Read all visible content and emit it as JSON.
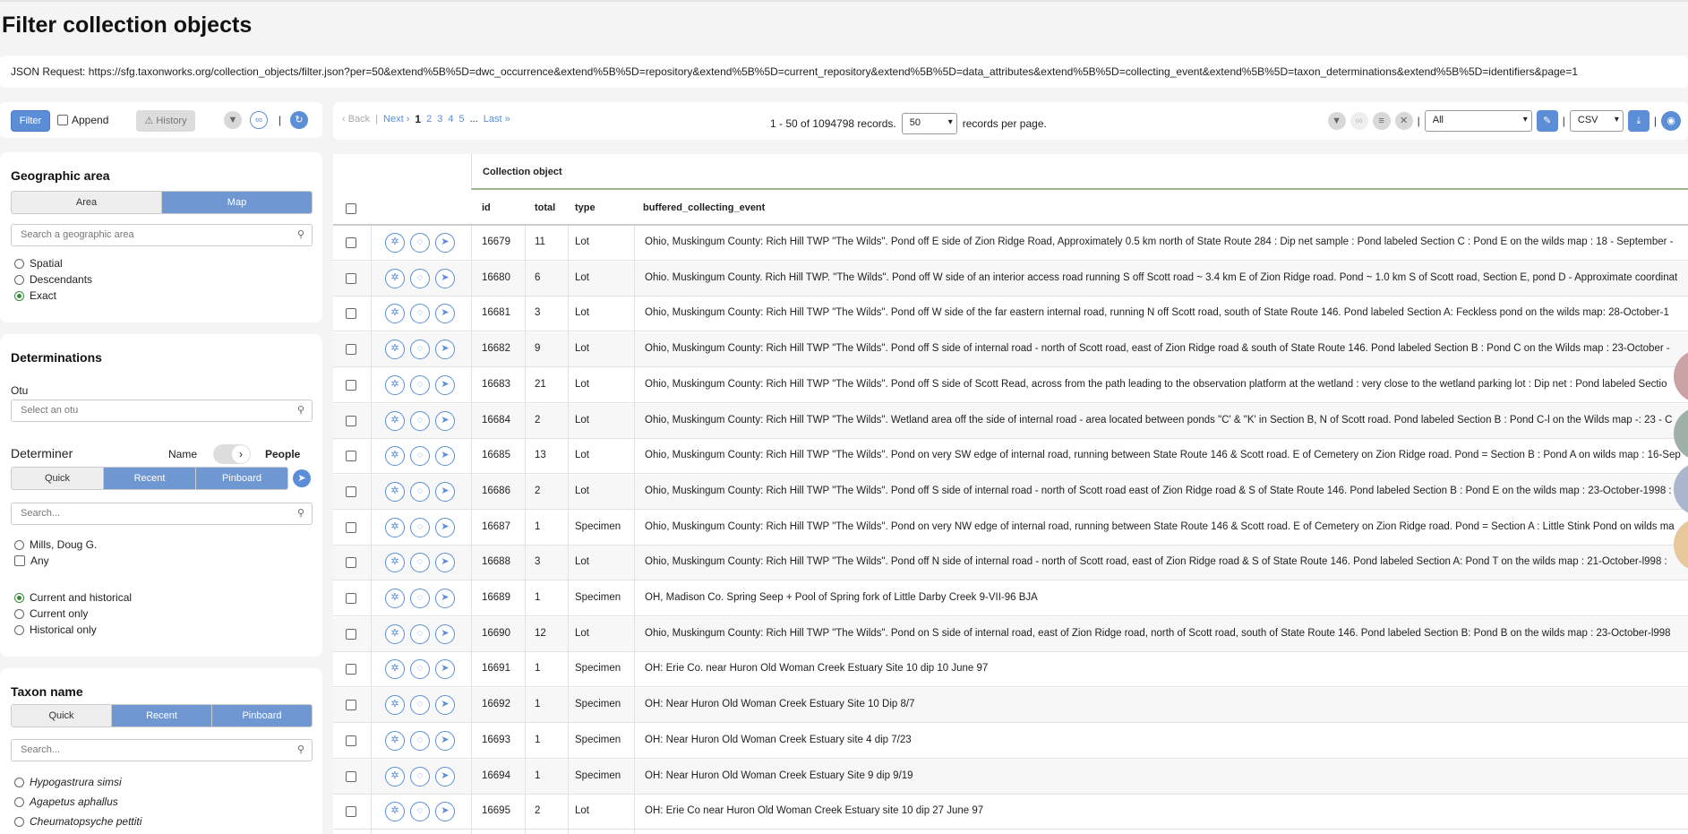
{
  "page": {
    "title": "Filter collection objects",
    "json_request": "JSON Request: https://sfg.taxonworks.org/collection_objects/filter.json?per=50&extend%5B%5D=dwc_occurrence&extend%5B%5D=repository&extend%5B%5D=current_repository&extend%5B%5D=data_attributes&extend%5B%5D=collecting_event&extend%5B%5D=taxon_determinations&extend%5B%5D=identifiers&page=1"
  },
  "filter_bar": {
    "filter_label": "Filter",
    "append_label": "Append",
    "history_label": "History",
    "pipe": "|"
  },
  "geographic": {
    "heading": "Geographic area",
    "tabs": [
      "Area",
      "Map"
    ],
    "placeholder": "Search a geographic area",
    "options": [
      "Spatial",
      "Descendants",
      "Exact"
    ]
  },
  "determinations": {
    "heading": "Determinations",
    "otu_label": "Otu",
    "otu_placeholder": "Select an otu",
    "determiner_label": "Determiner",
    "toggle_left": "Name",
    "toggle_right": "People",
    "tabs": [
      "Quick",
      "Recent",
      "Pinboard"
    ],
    "search_placeholder": "Search...",
    "person": "Mills, Doug G.",
    "any_label": "Any",
    "scope_options": [
      "Current and historical",
      "Current only",
      "Historical only"
    ]
  },
  "taxon": {
    "heading": "Taxon name",
    "tabs": [
      "Quick",
      "Recent",
      "Pinboard"
    ],
    "search_placeholder": "Search...",
    "names": [
      "Hypogastrura simsi",
      "Agapetus aphallus",
      "Cheumatopsyche pettiti"
    ]
  },
  "pager": {
    "back": "‹ Back",
    "sep": "|",
    "next": "Next ›",
    "pages": [
      "1",
      "2",
      "3",
      "4",
      "5"
    ],
    "ellipsis": "...",
    "last": "Last »",
    "records_text": "1 - 50 of 1094798 records.",
    "per_page_value": "50",
    "per_page_label": "records per page.",
    "layout_value": "All",
    "export_value": "CSV"
  },
  "table": {
    "group_header": "Collection object",
    "columns": [
      "id",
      "total",
      "type",
      "buffered_collecting_event"
    ],
    "rows": [
      {
        "id": "16679",
        "total": "11",
        "type": "Lot",
        "event": "Ohio, Muskingum County: Rich Hill TWP \"The Wilds\". Pond off E side of Zion Ridge Road, Approximately 0.5 km north of State Route 284 : Dip net sample : Pond labeled Section C : Pond E on the wilds map : 18 - September -"
      },
      {
        "id": "16680",
        "total": "6",
        "type": "Lot",
        "event": "Ohio. Muskingum County. Rich Hill TWP. \"The Wilds\". Pond off W side of an interior access road running S off Scott road ~ 3.4 km E of Zion Ridge road. Pond ~ 1.0 km S of Scott road, Section E, pond D - Approximate coordinat"
      },
      {
        "id": "16681",
        "total": "3",
        "type": "Lot",
        "event": "Ohio, Muskingum County: Rich Hill TWP \"The Wilds\". Pond off W side of the far eastern internal road, running N off Scott road, south of State Route 146. Pond labeled Section A: Feckless pond on the wilds map: 28-October-1"
      },
      {
        "id": "16682",
        "total": "9",
        "type": "Lot",
        "event": "Ohio, Muskingum County: Rich Hill TWP \"The Wilds\". Pond off S side of internal road - north of Scott road, east of Zion Ridge road & south of State Route 146. Pond labeled Section B : Pond C on the Wilds map : 23-October -"
      },
      {
        "id": "16683",
        "total": "21",
        "type": "Lot",
        "event": "Ohio, Muskingum County: Rich Hill TWP \"The Wilds\". Pond off S side of Scott Read, across from the path leading to the observation platform at the wetland : very close to the wetland parking lot : Dip net : Pond labeled Sectio"
      },
      {
        "id": "16684",
        "total": "2",
        "type": "Lot",
        "event": "Ohio, Muskingum County: Rich Hill TWP \"The Wilds\". Wetland area off the side of internal road - area located between ponds \"C' & \"K' in Section B, N of Scott road. Pond labeled Section B : Pond C-l on the Wilds map -: 23 - C"
      },
      {
        "id": "16685",
        "total": "13",
        "type": "Lot",
        "event": "Ohio, Muskingum County: Rich Hill TWP \"The Wilds\". Pond on very SW edge of internal road, running between State Route 146 & Scott road. E of Cemetery on Zion Ridge road. Pond = Section B : Pond A on wilds map : 16-Sep"
      },
      {
        "id": "16686",
        "total": "2",
        "type": "Lot",
        "event": "Ohio, Muskingum County: Rich Hill TWP \"The Wilds\". Pond off S side of internal road - north of Scott road east of Zion Ridge road & S of State Route 146. Pond labeled Section B : Pond E on the wilds map : 23-October-1998 : C"
      },
      {
        "id": "16687",
        "total": "1",
        "type": "Specimen",
        "event": "Ohio, Muskingum County: Rich Hill TWP \"The Wilds\". Pond on very NW edge of internal road, running between State Route 146 & Scott road. E of Cemetery on Zion Ridge road. Pond = Section A : Little Stink Pond on wilds ma"
      },
      {
        "id": "16688",
        "total": "3",
        "type": "Lot",
        "event": "Ohio, Muskingum County: Rich Hill TWP \"The Wilds\". Pond off N side of internal road - north of Scott road, east of Zion Ridge road & S of State Route 146. Pond labeled Section A: Pond T on the wilds map : 21-October-l998 :"
      },
      {
        "id": "16689",
        "total": "1",
        "type": "Specimen",
        "event": "OH, Madison Co. Spring Seep + Pool of Spring fork of Little Darby Creek 9-VII-96 BJA"
      },
      {
        "id": "16690",
        "total": "12",
        "type": "Lot",
        "event": "Ohio, Muskingum County: Rich Hill TWP \"The Wilds\". Pond on S side of internal road, east of Zion Ridge road, north of Scott road, south of State Route 146. Pond labeled Section B: Pond B on the wilds map : 23-October-l998"
      },
      {
        "id": "16691",
        "total": "1",
        "type": "Specimen",
        "event": "OH: Erie Co. near Huron Old Woman Creek Estuary Site 10 dip 10 June 97"
      },
      {
        "id": "16692",
        "total": "1",
        "type": "Specimen",
        "event": "OH: Near Huron Old Woman Creek Estuary Site 10 Dip 8/7"
      },
      {
        "id": "16693",
        "total": "1",
        "type": "Specimen",
        "event": "OH: Near Huron Old Woman Creek Estuary site 4 dip 7/23"
      },
      {
        "id": "16694",
        "total": "1",
        "type": "Specimen",
        "event": "OH: Near Huron Old Woman Creek Estuary Site 9 dip 9/19"
      },
      {
        "id": "16695",
        "total": "2",
        "type": "Lot",
        "event": "OH: Erie Co near Huron Old Woman Creek Estuary site 10 dip 27 June 97"
      }
    ]
  },
  "icons": {
    "filter": "▼",
    "link": "∞",
    "reset": "↻",
    "search": "⚲",
    "pencil": "✎",
    "download": "⤓",
    "eye": "◉",
    "layers": "≡",
    "trash": "✕",
    "pin": "➤",
    "row_radial": "✲",
    "row_circle": "◌",
    "row_nav": "➤"
  }
}
